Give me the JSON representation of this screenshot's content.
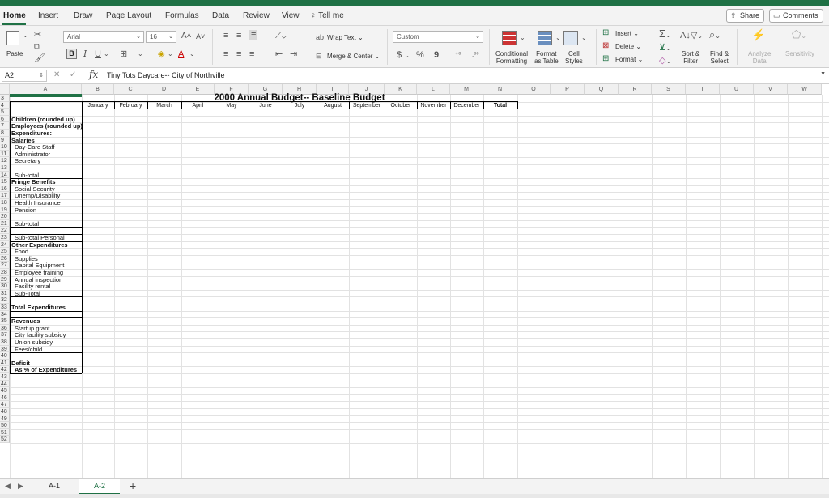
{
  "ribbon_tabs": [
    "Home",
    "Insert",
    "Draw",
    "Page Layout",
    "Formulas",
    "Data",
    "Review",
    "View"
  ],
  "tell_me": "Tell me",
  "share_label": "Share",
  "comments_label": "Comments",
  "ribbon": {
    "paste": "Paste",
    "font_name": "Arial",
    "font_size": "16",
    "wrap_text": "Wrap Text",
    "merge_center": "Merge & Center",
    "number_format": "Custom",
    "currency": "$",
    "percent": "%",
    "comma": "9",
    "conditional": [
      "Conditional",
      "Formatting"
    ],
    "format_table": [
      "Format",
      "as Table"
    ],
    "cell_styles": [
      "Cell",
      "Styles"
    ],
    "insert": "Insert",
    "delete": "Delete",
    "format": "Format",
    "sort_filter": [
      "Sort &",
      "Filter"
    ],
    "find_select": [
      "Find &",
      "Select"
    ],
    "analyze": [
      "Analyze",
      "Data"
    ],
    "sensitivity": "Sensitivity"
  },
  "name_box": "A2",
  "formula": "Tiny Tots Daycare-- City of Northville",
  "columns": [
    "A",
    "B",
    "C",
    "D",
    "E",
    "F",
    "G",
    "H",
    "I",
    "J",
    "K",
    "L",
    "M",
    "N",
    "O",
    "P",
    "Q",
    "R",
    "S",
    "T",
    "U",
    "V",
    "W"
  ],
  "visible_rows": [
    "3",
    "4",
    "5",
    "6",
    "7",
    "8",
    "9",
    "10",
    "11",
    "12",
    "13",
    "14",
    "15",
    "16",
    "17",
    "18",
    "19",
    "20",
    "21",
    "22",
    "23",
    "24",
    "25",
    "26",
    "27",
    "28",
    "29",
    "30",
    "31",
    "32",
    "33",
    "34",
    "35",
    "36",
    "37",
    "38",
    "39",
    "40",
    "41",
    "42",
    "43",
    "44",
    "45",
    "46",
    "47",
    "48",
    "49",
    "50",
    "51",
    "52"
  ],
  "sheet_title": "2000 Annual Budget-- Baseline Budget",
  "months": [
    "January",
    "February",
    "March",
    "April",
    "May",
    "June",
    "July",
    "August",
    "September",
    "October",
    "November",
    "December",
    "Total"
  ],
  "col_a": [
    {
      "row": "6",
      "text": "Children (rounded up)",
      "bold": true
    },
    {
      "row": "7",
      "text": "Employees (rounded up)",
      "bold": true
    },
    {
      "row": "8",
      "text": "Expenditures:",
      "bold": true
    },
    {
      "row": "9",
      "text": "Salaries",
      "bold": true
    },
    {
      "row": "10",
      "text": "Day-Care Staff",
      "indent": true
    },
    {
      "row": "11",
      "text": "Administrator",
      "indent": true
    },
    {
      "row": "12",
      "text": "Secretary",
      "indent": true
    },
    {
      "row": "14",
      "text": "Sub-total",
      "indent": true
    },
    {
      "row": "15",
      "text": "Fringe Benefits",
      "bold": true
    },
    {
      "row": "16",
      "text": "Social Security",
      "indent": true
    },
    {
      "row": "17",
      "text": "Unemp/Disability",
      "indent": true
    },
    {
      "row": "18",
      "text": "Health Insurance",
      "indent": true
    },
    {
      "row": "19",
      "text": "Pension",
      "indent": true
    },
    {
      "row": "21",
      "text": "Sub-total",
      "indent": true
    },
    {
      "row": "23",
      "text": "Sub-total Personal",
      "indent": true
    },
    {
      "row": "24",
      "text": "Other Expenditures",
      "bold": true
    },
    {
      "row": "25",
      "text": "Food",
      "indent": true
    },
    {
      "row": "26",
      "text": "Supplies",
      "indent": true
    },
    {
      "row": "27",
      "text": "Capital Equipment",
      "indent": true
    },
    {
      "row": "28",
      "text": "Employee training",
      "indent": true
    },
    {
      "row": "29",
      "text": "Annual inspection",
      "indent": true
    },
    {
      "row": "30",
      "text": "Facility rental",
      "indent": true
    },
    {
      "row": "31",
      "text": "Sub-Total",
      "indent": true
    },
    {
      "row": "33",
      "text": "Total Expenditures",
      "bold": true
    },
    {
      "row": "35",
      "text": "Revenues",
      "bold": true
    },
    {
      "row": "36",
      "text": "Startup grant",
      "indent": true
    },
    {
      "row": "37",
      "text": "City facility subsidy",
      "indent": true
    },
    {
      "row": "38",
      "text": "Union subsidy",
      "indent": true
    },
    {
      "row": "39",
      "text": "Fees/child",
      "indent": true
    },
    {
      "row": "41",
      "text": "Deficit",
      "bold": true
    },
    {
      "row": "42",
      "text": "As % of Expenditures",
      "bold": true,
      "indent": true
    }
  ],
  "sheets": [
    {
      "name": "A-1",
      "active": false
    },
    {
      "name": "A-2",
      "active": true
    }
  ]
}
